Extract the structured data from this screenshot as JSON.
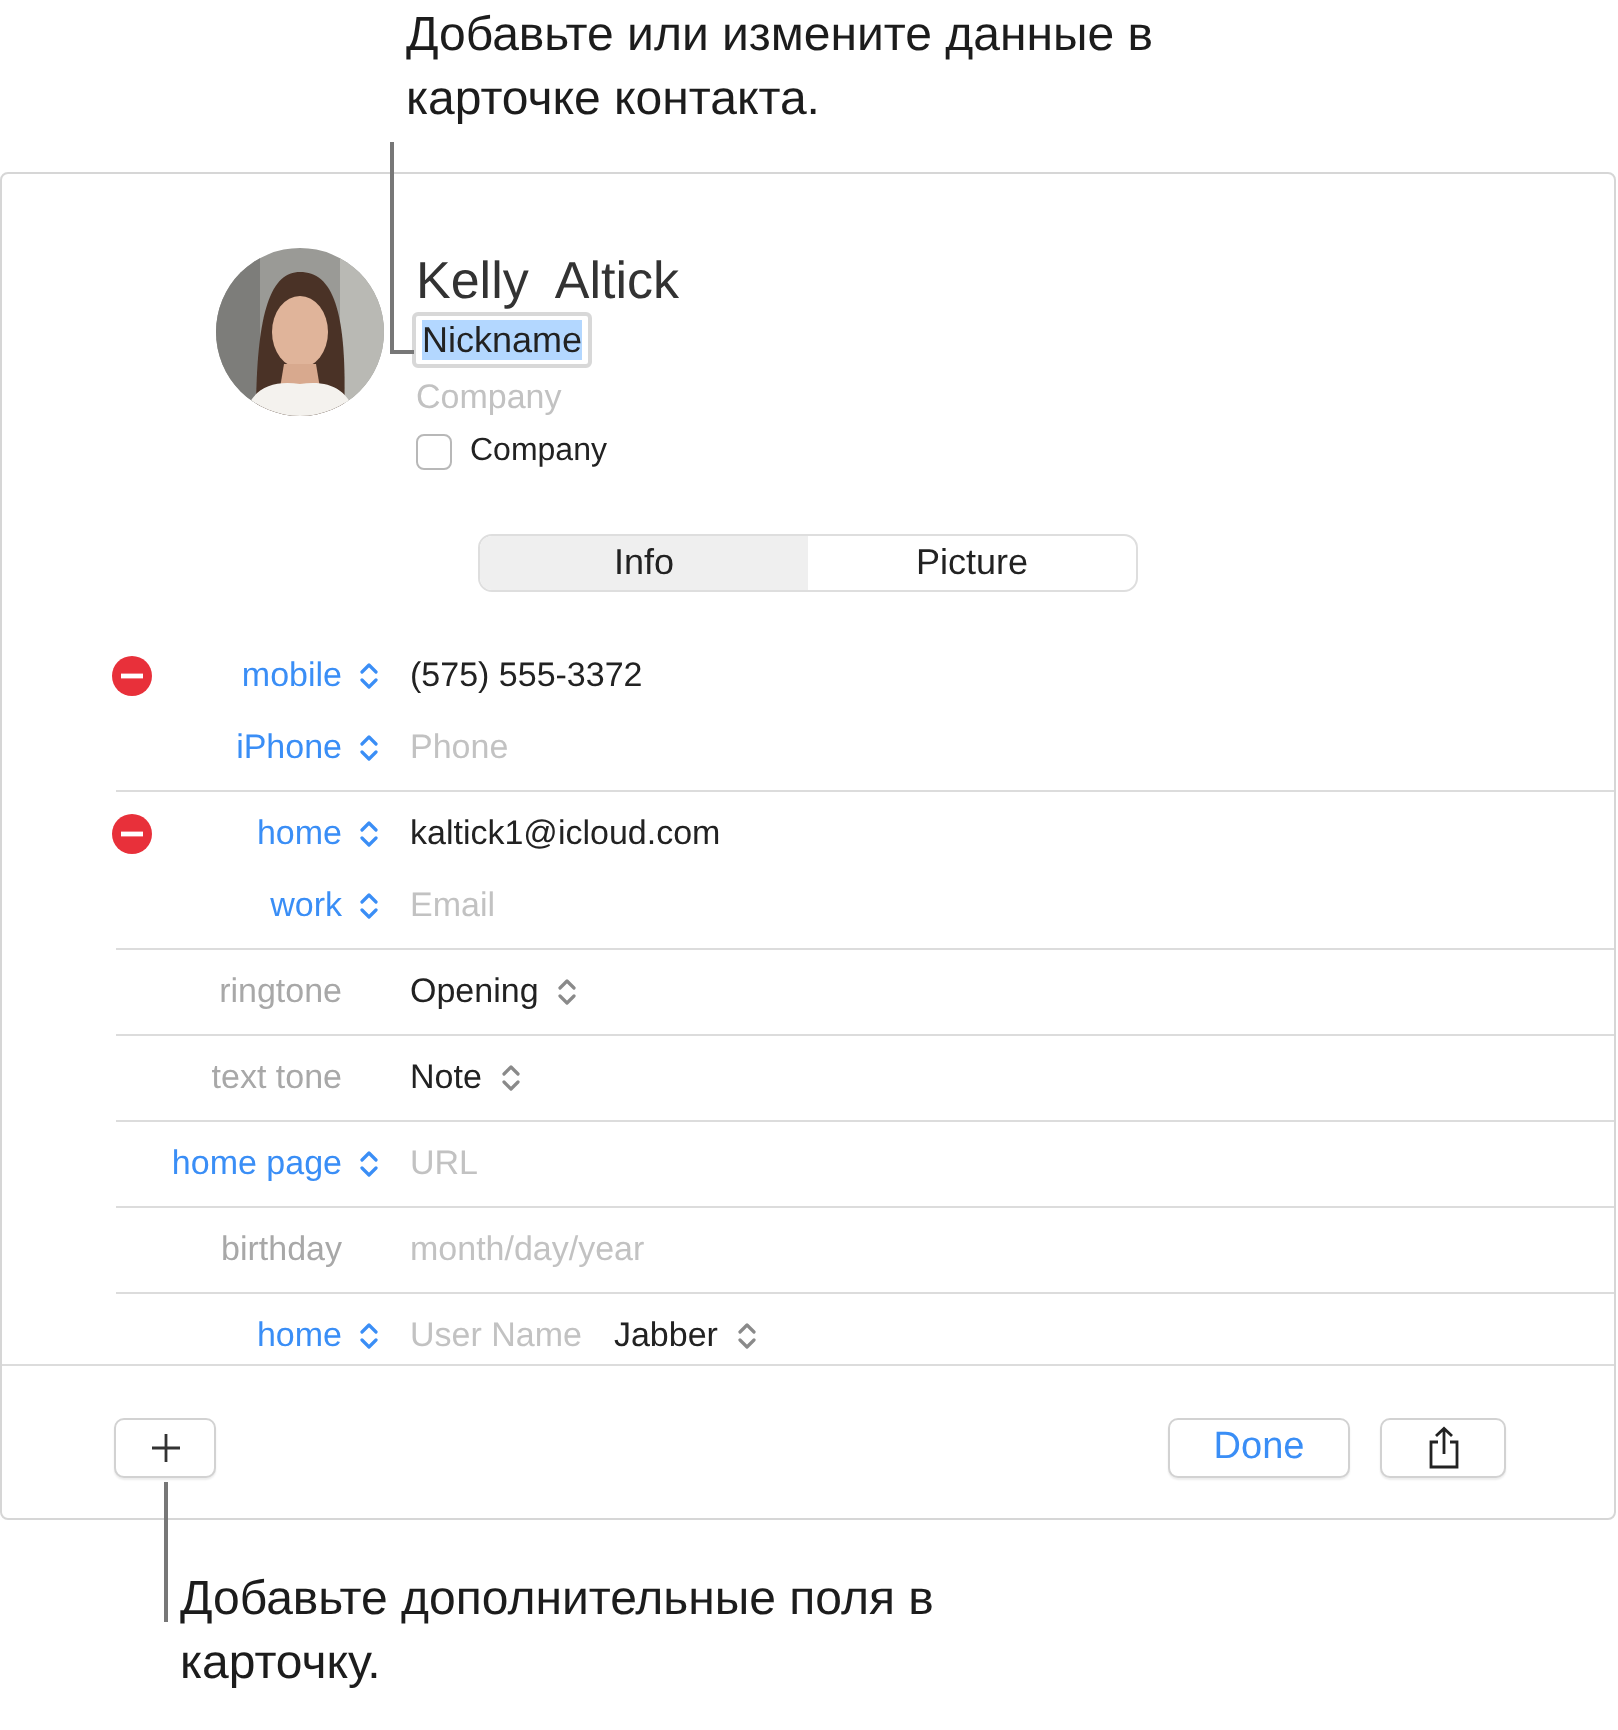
{
  "callout_top": "Добавьте или измените данные в карточке контакта.",
  "card": {
    "name": "Kelly  Altick",
    "nickname": {
      "value": "Nickname",
      "selected": true
    },
    "company_field": {
      "placeholder": "Company"
    },
    "company_checkbox": {
      "label": "Company",
      "checked": false
    },
    "tabs": [
      {
        "label": "Info",
        "selected": true
      },
      {
        "label": "Picture",
        "selected": false
      }
    ],
    "groups": [
      {
        "rows": [
          {
            "label": "mobile",
            "kind": "menu",
            "removable": true,
            "fields": [
              {
                "value": "(575) 555-3372",
                "menu": false
              }
            ]
          },
          {
            "label": "iPhone",
            "kind": "menu",
            "removable": false,
            "fields": [
              {
                "placeholder": "Phone",
                "menu": false
              }
            ]
          }
        ]
      },
      {
        "rows": [
          {
            "label": "home",
            "kind": "menu",
            "removable": true,
            "fields": [
              {
                "value": "kaltick1@icloud.com",
                "menu": false
              }
            ]
          },
          {
            "label": "work",
            "kind": "menu",
            "removable": false,
            "fields": [
              {
                "placeholder": "Email",
                "menu": false
              }
            ]
          }
        ]
      },
      {
        "rows": [
          {
            "label": "ringtone",
            "kind": "static",
            "removable": false,
            "fields": [
              {
                "value": "Opening",
                "menu": true
              }
            ]
          }
        ]
      },
      {
        "rows": [
          {
            "label": "text tone",
            "kind": "static",
            "removable": false,
            "fields": [
              {
                "value": "Note",
                "menu": true
              }
            ]
          }
        ]
      },
      {
        "rows": [
          {
            "label": "home page",
            "kind": "menu",
            "removable": false,
            "fields": [
              {
                "placeholder": "URL",
                "menu": false
              }
            ]
          }
        ]
      },
      {
        "rows": [
          {
            "label": "birthday",
            "kind": "static",
            "removable": false,
            "fields": [
              {
                "placeholder": "month/day/year",
                "menu": false
              }
            ]
          }
        ]
      },
      {
        "rows": [
          {
            "label": "home",
            "kind": "menu",
            "removable": false,
            "fields": [
              {
                "placeholder": "User Name",
                "menu": false
              },
              {
                "value": "Jabber",
                "menu": true
              }
            ]
          }
        ]
      }
    ],
    "done_button": "Done"
  },
  "callout_bottom": "Добавьте дополнительные поля в карточку."
}
